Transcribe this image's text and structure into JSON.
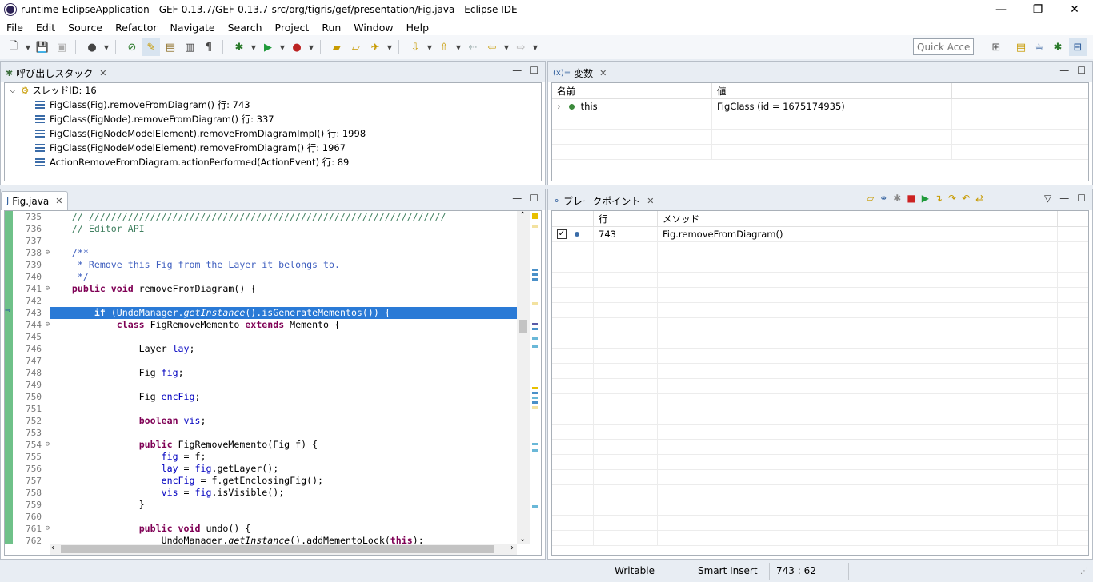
{
  "window": {
    "title": "runtime-EclipseApplication - GEF-0.13.7/GEF-0.13.7-src/org/tigris/gef/presentation/Fig.java - Eclipse IDE",
    "minimize": "—",
    "maximize": "❐",
    "close": "✕"
  },
  "menu": [
    "File",
    "Edit",
    "Source",
    "Refactor",
    "Navigate",
    "Search",
    "Project",
    "Run",
    "Window",
    "Help"
  ],
  "toolbar": {
    "quick_access": "Quick Access"
  },
  "callstack": {
    "tab_label": "呼び出しスタック",
    "thread_label": "スレッドID: 16",
    "frames": [
      "FigClass(Fig).removeFromDiagram() 行: 743",
      "FigClass(FigNode).removeFromDiagram() 行: 337",
      "FigClass(FigNodeModelElement).removeFromDiagramImpl() 行: 1998",
      "FigClass(FigNodeModelElement).removeFromDiagram() 行: 1967",
      "ActionRemoveFromDiagram.actionPerformed(ActionEvent) 行: 89"
    ]
  },
  "variables": {
    "tab_label": "変数",
    "tab_prefix": "(x)=",
    "col_name": "名前",
    "col_value": "値",
    "rows": [
      {
        "name": "this",
        "value": "FigClass (id = 1675174935)"
      }
    ]
  },
  "editor": {
    "tab_label": "Fig.java",
    "lines": [
      {
        "n": "735",
        "fold": "",
        "html": "<span class='cm'>    // ////////////////////////////////////////////////////////////////</span>"
      },
      {
        "n": "736",
        "fold": "",
        "html": "<span class='cm'>    // Editor API</span>"
      },
      {
        "n": "737",
        "fold": "",
        "html": ""
      },
      {
        "n": "738",
        "fold": "⊖",
        "html": "<span class='jd'>    /**</span>"
      },
      {
        "n": "739",
        "fold": "",
        "html": "<span class='jd'>     * Remove this Fig from the Layer it belongs to.</span>"
      },
      {
        "n": "740",
        "fold": "",
        "html": "<span class='jd'>     */</span>"
      },
      {
        "n": "741",
        "fold": "⊖",
        "html": "    <span class='kw'>public void</span> removeFromDiagram() {"
      },
      {
        "n": "742",
        "fold": "",
        "html": ""
      },
      {
        "n": "743",
        "fold": "",
        "html": "        <span class='kw'>if</span> (UndoManager.<span class='it'>getInstance</span>().isGenerateMementos()) {",
        "hl": true
      },
      {
        "n": "744",
        "fold": "⊖",
        "html": "            <span class='kw'>class</span> FigRemoveMemento <span class='kw'>extends</span> Memento {"
      },
      {
        "n": "745",
        "fold": "",
        "html": ""
      },
      {
        "n": "746",
        "fold": "",
        "html": "                Layer <span class='fld'>lay</span>;"
      },
      {
        "n": "747",
        "fold": "",
        "html": ""
      },
      {
        "n": "748",
        "fold": "",
        "html": "                Fig <span class='fld'>fig</span>;"
      },
      {
        "n": "749",
        "fold": "",
        "html": ""
      },
      {
        "n": "750",
        "fold": "",
        "html": "                Fig <span class='fld'>encFig</span>;"
      },
      {
        "n": "751",
        "fold": "",
        "html": ""
      },
      {
        "n": "752",
        "fold": "",
        "html": "                <span class='kw'>boolean</span> <span class='fld'>vis</span>;"
      },
      {
        "n": "753",
        "fold": "",
        "html": ""
      },
      {
        "n": "754",
        "fold": "⊖",
        "html": "                <span class='kw'>public</span> FigRemoveMemento(Fig f) {"
      },
      {
        "n": "755",
        "fold": "",
        "html": "                    <span class='fld'>fig</span> = f;"
      },
      {
        "n": "756",
        "fold": "",
        "html": "                    <span class='fld'>lay</span> = <span class='fld'>fig</span>.getLayer();"
      },
      {
        "n": "757",
        "fold": "",
        "html": "                    <span class='fld'>encFig</span> = f.getEnclosingFig();"
      },
      {
        "n": "758",
        "fold": "",
        "html": "                    <span class='fld'>vis</span> = <span class='fld'>fig</span>.isVisible();"
      },
      {
        "n": "759",
        "fold": "",
        "html": "                }"
      },
      {
        "n": "760",
        "fold": "",
        "html": ""
      },
      {
        "n": "761",
        "fold": "⊖",
        "html": "                <span class='kw'>public void</span> undo() {"
      },
      {
        "n": "762",
        "fold": "",
        "html": "                    UndoManager.<span class='it'>getInstance</span>().addMementoLock(<span class='kw'>this</span>);"
      }
    ]
  },
  "breakpoints": {
    "tab_label": "ブレークポイント",
    "col_line": "行",
    "col_method": "メソッド",
    "rows": [
      {
        "line": "743",
        "method": "Fig.removeFromDiagram()"
      }
    ]
  },
  "status": {
    "writable": "Writable",
    "insert_mode": "Smart Insert",
    "position": "743 : 62"
  }
}
